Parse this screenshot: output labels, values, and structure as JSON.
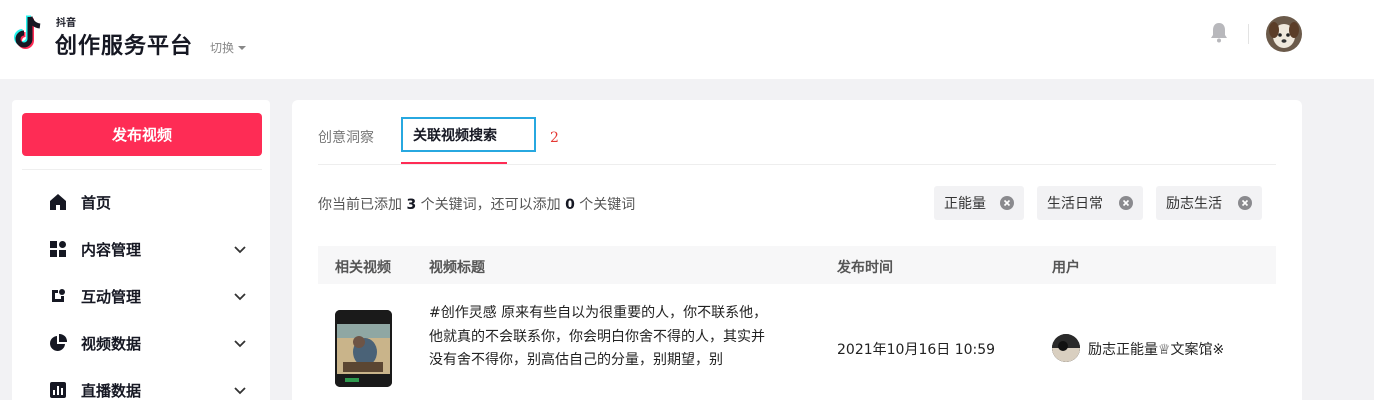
{
  "header": {
    "brand_small": "抖音",
    "brand_name": "创作服务平台",
    "switch_label": "切换"
  },
  "sidebar": {
    "publish_label": "发布视频",
    "items": [
      {
        "label": "首页",
        "icon": "home-icon",
        "has_chevron": false
      },
      {
        "label": "内容管理",
        "icon": "grid-icon",
        "has_chevron": true
      },
      {
        "label": "互动管理",
        "icon": "interaction-icon",
        "has_chevron": true
      },
      {
        "label": "视频数据",
        "icon": "pie-chart-icon",
        "has_chevron": true
      },
      {
        "label": "直播数据",
        "icon": "bar-chart-icon",
        "has_chevron": true
      }
    ]
  },
  "main": {
    "tabs": [
      {
        "label": "创意洞察",
        "active": false
      },
      {
        "label": "关联视频搜索",
        "active": true
      }
    ],
    "annotation": "2",
    "keyword_info": {
      "prefix": "你当前已添加 ",
      "added_count": "3",
      "middle": " 个关键词，还可以添加 ",
      "remaining_count": "0",
      "suffix": " 个关键词"
    },
    "keywords": [
      "正能量",
      "生活日常",
      "励志生活"
    ],
    "table": {
      "headers": [
        "相关视频",
        "视频标题",
        "发布时间",
        "用户"
      ],
      "rows": [
        {
          "title": "#创作灵感 原来有些自以为很重要的人，你不联系他，他就真的不会联系你，你会明白你舍不得的人，其实并没有舍不得你，别高估自己的分量，别期望，别",
          "time": "2021年10月16日 10:59",
          "user": "励志正能量♕文案馆※"
        }
      ]
    }
  },
  "colors": {
    "accent": "#fe2c55",
    "annotation_box": "#27a8e0",
    "annotation_text": "#e53935"
  }
}
